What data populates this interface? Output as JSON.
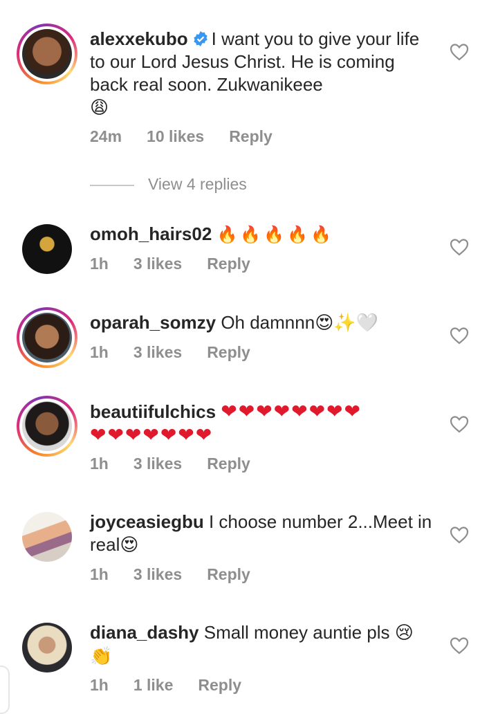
{
  "comments": [
    {
      "username": "alexxekubo",
      "verified": true,
      "text": "I want you to give your life to our Lord Jesus Christ. He is coming back real soon. Zukwanikeee",
      "emoji": "😩",
      "time": "24m",
      "likes": "10 likes",
      "reply": "Reply",
      "view_replies": "View 4 replies"
    },
    {
      "username": "omoh_hairs02",
      "text": "",
      "emoji": "🔥🔥🔥🔥🔥",
      "time": "1h",
      "likes": "3 likes",
      "reply": "Reply"
    },
    {
      "username": "oparah_somzy",
      "text": "Oh damnnn",
      "emoji": "😍✨🤍",
      "time": "1h",
      "likes": "3 likes",
      "reply": "Reply"
    },
    {
      "username": "beautiifulchics",
      "text": "",
      "emoji": "❤❤❤❤❤❤❤❤",
      "emoji_line2": "❤❤❤❤❤❤❤",
      "time": "1h",
      "likes": "3 likes",
      "reply": "Reply"
    },
    {
      "username": "joyceasiegbu",
      "text": "I choose number 2...Meet in real",
      "emoji": "😍",
      "time": "1h",
      "likes": "3 likes",
      "reply": "Reply"
    },
    {
      "username": "diana_dashy",
      "text": "Small money auntie pls",
      "emoji": "😢",
      "emoji_line2": "👏",
      "time": "1h",
      "likes": "1 like",
      "reply": "Reply"
    }
  ],
  "colors": {
    "secondary_text": "#8e8e8e",
    "verified": "#3897f0",
    "heart_red": "#e0192d"
  },
  "icons": {
    "like": "heart-outline-icon",
    "verified": "verified-badge-icon"
  }
}
